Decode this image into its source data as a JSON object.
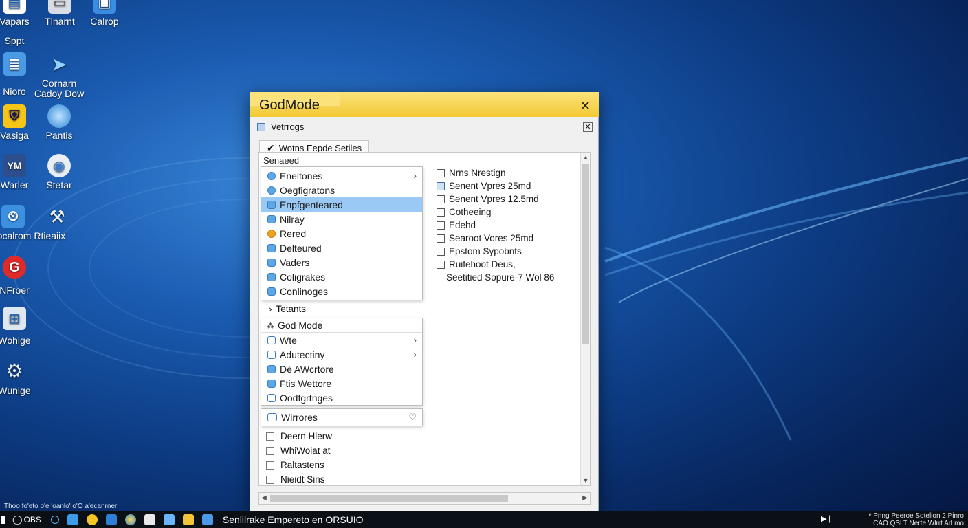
{
  "desktop": {
    "icons": [
      {
        "label": "Vapars",
        "label2": "Sppt"
      },
      {
        "label": "Tlnarnt"
      },
      {
        "label": "Calrop"
      },
      {
        "label": "Nioro"
      },
      {
        "label": "Cornarn",
        "label2": "Cadoy Dow"
      },
      {
        "label": "Vasiga"
      },
      {
        "label": "Pantis"
      },
      {
        "label": "Warler"
      },
      {
        "label": "Stetar"
      },
      {
        "label": "Inocalrom Rtieaiix"
      },
      {
        "label": "NFroer"
      },
      {
        "label": "Wohige"
      },
      {
        "label": "Wunige"
      }
    ],
    "note": "Thoo fo'eto o'e 'oanlo' o'O a'ecanrner"
  },
  "window": {
    "title": "GodMode",
    "close_glyph": "✕",
    "subbar_label": "Vetrrogs",
    "tab_label": "Wotns Eepde Setiles",
    "section1_label": "Senaeed",
    "menu1": [
      {
        "label": "Eneltones",
        "icon": "round",
        "chevron": "›"
      },
      {
        "label": "Oegfigratons",
        "icon": "round"
      },
      {
        "label": "Enpfgenteared",
        "icon": "square",
        "selected": true
      },
      {
        "label": "Nilray",
        "icon": "square"
      },
      {
        "label": "Rered",
        "icon": "orange"
      },
      {
        "label": "Delteured",
        "icon": "square"
      },
      {
        "label": "Vaders",
        "icon": "square"
      },
      {
        "label": "Coligrakes",
        "icon": "square"
      },
      {
        "label": "Conlinoges",
        "icon": "square"
      }
    ],
    "checklist": [
      {
        "label": "Nrns Nrestign",
        "box": "plain"
      },
      {
        "label": "Senent Vpres 25md",
        "box": "fill"
      },
      {
        "label": "Senent Vpres 12.5md",
        "box": "plain"
      },
      {
        "label": "Cotheeing",
        "box": "plain"
      },
      {
        "label": "Edehd",
        "box": "plain"
      },
      {
        "label": "Searoot Vores 25md",
        "box": "plain"
      },
      {
        "label": "Epstom Sypobnts",
        "box": "plain"
      },
      {
        "label": "Ruifehoot Deus,",
        "box": "plain"
      },
      {
        "label": "Seetitied Sopure-7 Wol 86",
        "box": "none"
      }
    ],
    "tetants_label": "Tetants",
    "group2_title": "God Mode",
    "menu2": [
      {
        "label": "Wte",
        "icon": "outline",
        "chevron": "›"
      },
      {
        "label": "Adutectiny",
        "icon": "outline",
        "chevron": "›"
      },
      {
        "label": "Dé AWcrtore",
        "icon": "square"
      },
      {
        "label": "Ftis Wettore",
        "icon": "square"
      },
      {
        "label": "Oodfgrtnges",
        "icon": "outline"
      }
    ],
    "wirrores_label": "Wirrores",
    "wirrores_glyph": "♡",
    "lower_items": [
      "Deern Hlerw",
      "WhiWoiat at",
      "Raltastens",
      "Nieidt Sins"
    ]
  },
  "taskbar": {
    "start_label": "OBS",
    "running_title": "Senlilrake Empereto en ORSUIO",
    "media_glyph": "▶❙",
    "tray_line1": "ᵉ Pnng   Peeroe   Sotelion   2 Pinro",
    "tray_line2": "CAO  QSLT   Nerte   Wlrrt   Arl mo"
  }
}
